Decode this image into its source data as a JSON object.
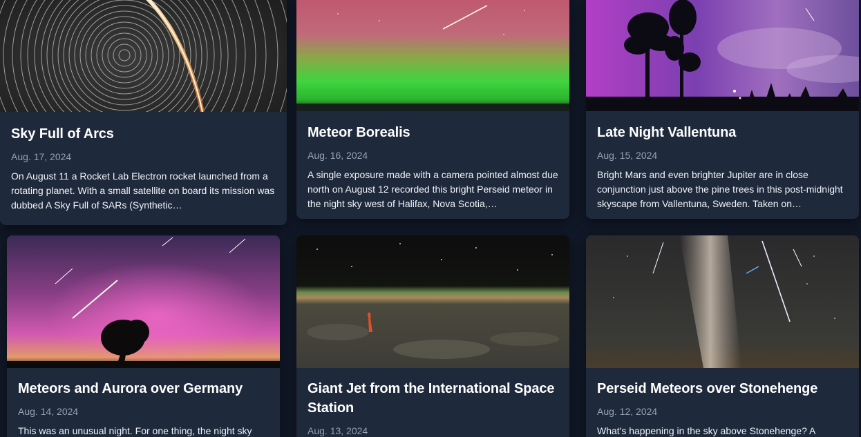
{
  "cards": [
    {
      "title": "Sky Full of Arcs",
      "date": "Aug. 17, 2024",
      "description": "On August 11 a Rocket Lab Electron rocket launched from a rotating planet. With a small satellite on board its mission was dubbed A Sky Full of SARs (Synthetic…"
    },
    {
      "title": "Meteor Borealis",
      "date": "Aug. 16, 2024",
      "description": "A single exposure made with a camera pointed almost due north on August 12 recorded this bright Perseid meteor in the night sky west of Halifax, Nova Scotia,…"
    },
    {
      "title": "Late Night Vallentuna",
      "date": "Aug. 15, 2024",
      "description": "Bright Mars and even brighter Jupiter are in close conjunction just above the pine trees in this post-midnight skyscape from Vallentuna, Sweden. Taken on…"
    },
    {
      "title": "Meteors and Aurora over Germany",
      "date": "Aug. 14, 2024",
      "description": "This was an unusual night. For one thing, the night sky"
    },
    {
      "title": "Giant Jet from the International Space Station",
      "date": "Aug. 13, 2024",
      "description": ""
    },
    {
      "title": "Perseid Meteors over Stonehenge",
      "date": "Aug. 12, 2024",
      "description": "What's happening in the sky above Stonehenge? A"
    }
  ],
  "images": [
    {
      "icon": "star-trails-image"
    },
    {
      "icon": "meteor-aurora-image"
    },
    {
      "icon": "pine-silhouette-night-image"
    },
    {
      "icon": "aurora-meteors-tree-image"
    },
    {
      "icon": "earth-limb-sprite-image"
    },
    {
      "icon": "milky-way-meteors-image"
    }
  ],
  "colors": {
    "page_background": "#111827",
    "card_background": "#1e293b",
    "title": "#ffffff",
    "date": "#94a3b8",
    "description": "#f1f5f9"
  }
}
